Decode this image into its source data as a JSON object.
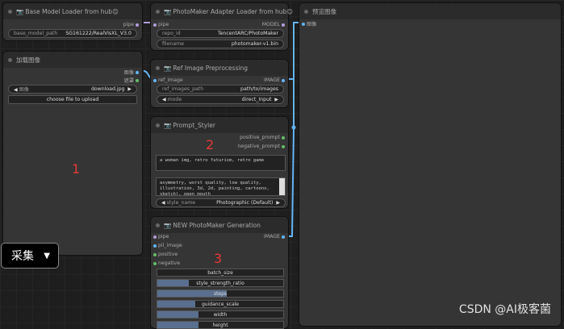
{
  "nodes": {
    "base_model": {
      "title": "Base Model Loader from hub😊",
      "out_label": "pipe",
      "field_label": "base_model_path",
      "field_value": "SG161222/RealVisXL_V3.0"
    },
    "load_image": {
      "title": "加载图像",
      "out_image": "图像",
      "out_mask": "遮罩",
      "image_label": "图像",
      "image_value": "download.jpg",
      "upload_button": "choose file to upload"
    },
    "adapter": {
      "title": "PhotoMaker Adapter Loader from hub😊",
      "in_label": "pipe",
      "out_label": "MODEL",
      "repo_label": "repo_id",
      "repo_value": "TencentARC/PhotoMaker",
      "file_label": "filename",
      "file_value": "photomaker-v1.bin"
    },
    "ref": {
      "title": "Ref Image Preprocessing",
      "in_label": "ref_image",
      "out_label": "IMAGE",
      "path_label": "ref_images_path",
      "path_value": "path/to/images",
      "mode_label": "mode",
      "mode_value": "direct_Input"
    },
    "styler": {
      "title": "Prompt_Styler",
      "out_pos": "positive_prompt",
      "out_neg": "negative_prompt",
      "pos_text": "a woman img, retro futurism, retro game",
      "neg_text": "asymmetry, worst quality, low quality, illustration, 3d, 2d, painting, cartoons, sketch), open mouth",
      "style_label": "style_name",
      "style_value": "Photographic (Default)"
    },
    "gen": {
      "title": "NEW PhotoMaker Generation",
      "in_pipe": "pipe",
      "in_pil": "pil_image",
      "in_pos": "positive",
      "in_neg": "negative",
      "out_label": "IMAGE",
      "params": [
        {
          "label": "batch_size",
          "fill": 0.0
        },
        {
          "label": "style_strength_ratio",
          "fill": 0.25
        },
        {
          "label": "steps",
          "fill": 0.55
        },
        {
          "label": "guidance_scale",
          "fill": 0.3
        },
        {
          "label": "width",
          "fill": 0.33
        },
        {
          "label": "height",
          "fill": 0.33
        }
      ]
    },
    "preview": {
      "title": "预览图像",
      "in_label": "图像"
    }
  },
  "annotations": {
    "one": "1",
    "two": "2",
    "three": "3"
  },
  "tag": {
    "label": "采集",
    "arrow": "▼"
  },
  "watermark": "CSDN @AI极客菌"
}
